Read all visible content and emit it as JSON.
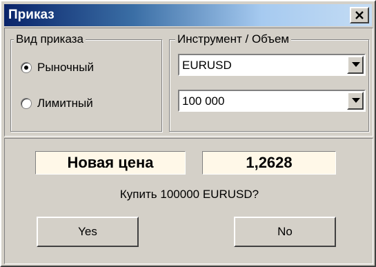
{
  "window": {
    "title": "Приказ"
  },
  "order_type": {
    "legend": "Вид приказа",
    "options": [
      {
        "label": "Рыночный",
        "selected": true
      },
      {
        "label": "Лимитный",
        "selected": false
      }
    ]
  },
  "instrument": {
    "legend": "Инструмент / Объем",
    "symbol_value": "EURUSD",
    "volume_value": "100 000"
  },
  "price": {
    "label": "Новая цена",
    "value": "1,2628"
  },
  "confirm": {
    "question": "Купить 100000 EURUSD?",
    "yes_label": "Yes",
    "no_label": "No"
  },
  "icons": {
    "close": "close-icon",
    "dropdown": "chevron-down-icon",
    "radio_selected": "radio-selected-icon",
    "radio_unselected": "radio-unselected-icon"
  },
  "colors": {
    "title_gradient_start": "#0a246a",
    "title_gradient_end": "#c4dcf4",
    "dialog_face": "#d4d0c8",
    "price_box_bg": "#fff8e8"
  }
}
